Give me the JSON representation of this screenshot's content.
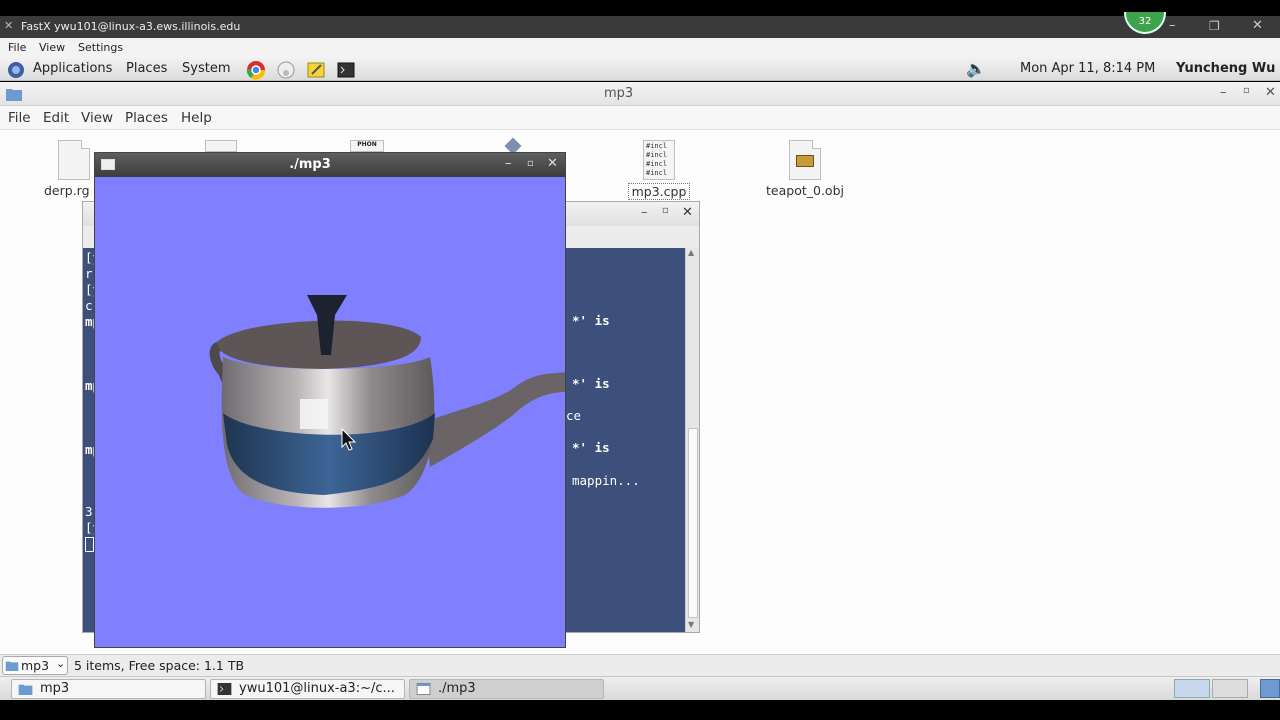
{
  "fastx": {
    "title": "FastX ywu101@linux-a3.ews.illinois.edu",
    "badge": "32",
    "menu": [
      "File",
      "View",
      "Settings"
    ]
  },
  "panel": {
    "applications": "Applications",
    "places": "Places",
    "system": "System",
    "datetime": "Mon Apr 11,  8:14 PM",
    "user": "Yuncheng Wu"
  },
  "file_manager": {
    "title": "mp3",
    "menu": [
      "File",
      "Edit",
      "View",
      "Places",
      "Help"
    ],
    "files": [
      {
        "name": "derp.rg",
        "icon": "text-file-icon"
      },
      {
        "name": "mp3.cpp",
        "icon": "cpp-file-icon"
      },
      {
        "name": "teapot_0.obj",
        "icon": "image-file-icon"
      }
    ],
    "php_label": "PHON",
    "cpp_lines": [
      "#incl",
      "#incl",
      "#incl",
      "#incl"
    ],
    "status_location": "mp3",
    "status_text": "5 items, Free space: 1.1 TB"
  },
  "terminal": {
    "left_lines": [
      "[y",
      "rr",
      "[y",
      "c",
      "mp",
      "mp",
      "mp",
      "3",
      "[y"
    ],
    "lines": [
      "*' is",
      "*' is",
      "ce",
      "*' is",
      "mappin..."
    ]
  },
  "gl_window": {
    "title": "./mp3",
    "background": "#8080ff"
  },
  "taskbar": [
    {
      "label": "mp3",
      "icon": "folder-icon",
      "active": false
    },
    {
      "label": "ywu101@linux-a3:~/c...",
      "icon": "terminal-icon",
      "active": false
    },
    {
      "label": "./mp3",
      "icon": "window-icon",
      "active": true
    }
  ]
}
